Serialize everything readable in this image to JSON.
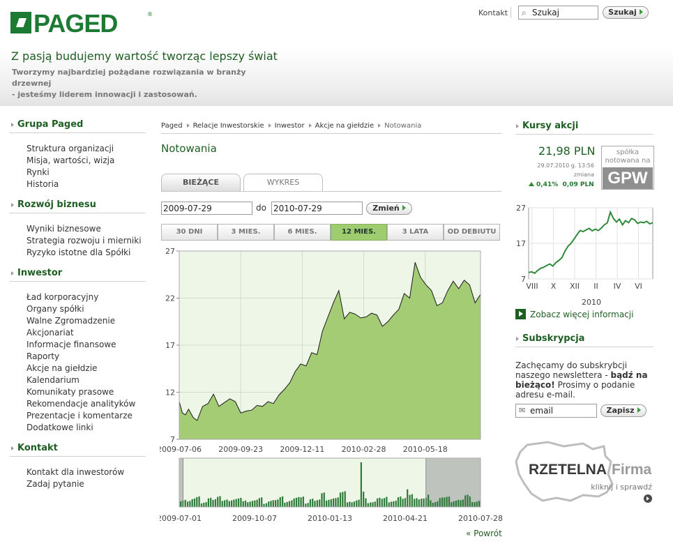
{
  "header": {
    "logo_text": "PAGED",
    "logo_reg": "®",
    "top_contact": "Kontakt",
    "search_placeholder": "Szukaj",
    "search_button": "Szukaj",
    "tagline": "Z pasją budujemy wartość tworząc lepszy świat",
    "subtagline_1": "Tworzymy najbardziej pożądane rozwiązania w branży drzewnej",
    "subtagline_2": "- jesteśmy liderem innowacji i zastosowań."
  },
  "sidebar": {
    "sections": [
      {
        "title": "Grupa Paged",
        "items": [
          "Struktura organizacji",
          "Misja, wartości, wizja",
          "Rynki",
          "Historia"
        ]
      },
      {
        "title": "Rozwój biznesu",
        "items": [
          "Wyniki biznesowe",
          "Strategia rozwoju i mierniki",
          "Ryzyko istotne dla Spółki"
        ]
      },
      {
        "title": "Inwestor",
        "items": [
          "Ład korporacyjny",
          "Organy spółki",
          "Walne Zgromadzenie",
          "Akcjonariat",
          "Informacje finansowe",
          "Raporty",
          "Akcje na giełdzie",
          "Kalendarium",
          "Komunikaty prasowe",
          "Rekomendacje analityków",
          "Prezentacje i komentarze",
          "Dodatkowe linki"
        ]
      },
      {
        "title": "Kontakt",
        "items": [
          "Kontakt dla inwestorów",
          "Zadaj pytanie"
        ]
      }
    ]
  },
  "breadcrumb": [
    "Paged",
    "Relacje Inwestorskie",
    "Inwestor",
    "Akcje na giełdzie",
    "Notowania"
  ],
  "main": {
    "title": "Notowania",
    "tabs": [
      {
        "label": "BIEŻĄCE",
        "active": true
      },
      {
        "label": "WYKRES",
        "active": false
      }
    ],
    "date_from": "2009-07-29",
    "date_to_label": "do",
    "date_to": "2010-07-29",
    "change_button": "Zmień",
    "ranges": [
      {
        "label": "30 DNI",
        "active": false
      },
      {
        "label": "3 MIES.",
        "active": false
      },
      {
        "label": "6 MIES.",
        "active": false
      },
      {
        "label": "12 MIES.",
        "active": true
      },
      {
        "label": "3 LATA",
        "active": false
      },
      {
        "label": "OD DEBIUTU",
        "active": false
      }
    ],
    "back_link": "« Powrót"
  },
  "chart_data": [
    {
      "type": "area",
      "y_ticks": [
        "27",
        "22",
        "17",
        "12",
        "7"
      ],
      "ylim": [
        7,
        27
      ],
      "x_ticks": [
        "2009-07-06",
        "2009-09-23",
        "2009-12-11",
        "2010-02-28",
        "2010-05-18"
      ],
      "xlim": [
        "2009-07-06",
        "2010-07-28"
      ],
      "grid": true,
      "fill_color": "#a4cc75",
      "line_color": "#1a1a1a",
      "x": [
        "2009-07-06",
        "2009-07-10",
        "2009-07-14",
        "2009-07-18",
        "2009-07-24",
        "2009-07-29",
        "2009-08-05",
        "2009-08-12",
        "2009-08-19",
        "2009-08-26",
        "2009-09-02",
        "2009-09-09",
        "2009-09-16",
        "2009-09-23",
        "2009-09-30",
        "2009-10-07",
        "2009-10-14",
        "2009-10-21",
        "2009-10-28",
        "2009-11-04",
        "2009-11-11",
        "2009-11-18",
        "2009-11-25",
        "2009-12-02",
        "2009-12-09",
        "2009-12-16",
        "2009-12-23",
        "2009-12-30",
        "2010-01-06",
        "2010-01-13",
        "2010-01-20",
        "2010-01-27",
        "2010-02-03",
        "2010-02-10",
        "2010-02-17",
        "2010-02-24",
        "2010-03-03",
        "2010-03-10",
        "2010-03-17",
        "2010-03-24",
        "2010-03-31",
        "2010-04-07",
        "2010-04-14",
        "2010-04-21",
        "2010-04-28",
        "2010-05-05",
        "2010-05-12",
        "2010-05-19",
        "2010-05-26",
        "2010-06-02",
        "2010-06-09",
        "2010-06-16",
        "2010-06-23",
        "2010-06-30",
        "2010-07-07",
        "2010-07-14",
        "2010-07-21",
        "2010-07-28"
      ],
      "y": [
        11.0,
        9.8,
        9.6,
        10.2,
        9.3,
        9.0,
        10.5,
        10.8,
        11.8,
        10.5,
        10.9,
        11.3,
        11.0,
        9.8,
        10.0,
        10.1,
        10.6,
        10.5,
        11.0,
        10.8,
        11.7,
        12.3,
        13.0,
        14.2,
        15.0,
        14.8,
        16.2,
        16.0,
        18.5,
        20.0,
        21.5,
        22.8,
        19.8,
        20.5,
        20.3,
        19.9,
        20.0,
        20.4,
        20.2,
        19.0,
        19.5,
        20.2,
        20.8,
        22.5,
        22.0,
        25.8,
        24.2,
        23.4,
        22.8,
        21.2,
        21.5,
        22.8,
        23.8,
        23.0,
        23.9,
        23.4,
        21.5,
        22.4,
        22.9
      ]
    },
    {
      "type": "bar",
      "title": "",
      "x_ticks": [
        "2009-07-01",
        "2009-10-07",
        "2010-01-13",
        "2010-04-21",
        "2010-07-28"
      ],
      "selected_range": [
        "2009-07-06",
        "2010-05-18"
      ],
      "bar_color": "#2e7a3b"
    },
    {
      "type": "line",
      "y_ticks": [
        "27",
        "17",
        "7"
      ],
      "ylim": [
        7,
        27
      ],
      "x_ticks": [
        "VIII",
        "X",
        "XII",
        "II",
        "IV",
        "VI"
      ],
      "xlabel": "2010",
      "values": [
        8.8,
        9.0,
        8.6,
        9.4,
        10.0,
        10.3,
        10.8,
        11.2,
        10.6,
        11.6,
        12.2,
        13.0,
        14.8,
        16.2,
        17.0,
        18.2,
        19.5,
        20.6,
        20.3,
        20.8,
        21.2,
        20.5,
        21.0,
        20.6,
        21.3,
        22.2,
        22.8,
        25.8,
        24.0,
        23.0,
        23.8,
        22.2,
        23.4,
        22.8,
        24.0,
        23.6,
        22.6,
        23.0,
        22.8,
        23.2,
        22.5,
        22.8
      ]
    }
  ],
  "quote": {
    "title": "Kursy akcji",
    "price": "21,98 PLN",
    "date_line": "29.07.2010 g. 13:56",
    "zmiana_label": "zmiana",
    "change_pct": "0,41%",
    "change_abs": "0,09 PLN",
    "gpw_line1": "spółka",
    "gpw_line2": "notowana na",
    "gpw_line3": "GPW",
    "more_link": "Zobacz więcej informacji"
  },
  "subscription": {
    "title": "Subskrypcja",
    "text_1": "Zachęcamy do subskrybcji naszego newslettera - ",
    "text_bold": "bądź na bieżąco!",
    "text_2": " Prosimy o podanie adresu e-mail.",
    "email_placeholder": "email",
    "submit": "Zapisz"
  },
  "badge": {
    "title_1": "RZETELNA",
    "title_2": "Firma",
    "subtitle": "kliknij i sprawdź"
  },
  "colors": {
    "brand_green": "#1c7a33",
    "heading_green": "#1e5e22",
    "active_range": "#9dcd6e"
  }
}
